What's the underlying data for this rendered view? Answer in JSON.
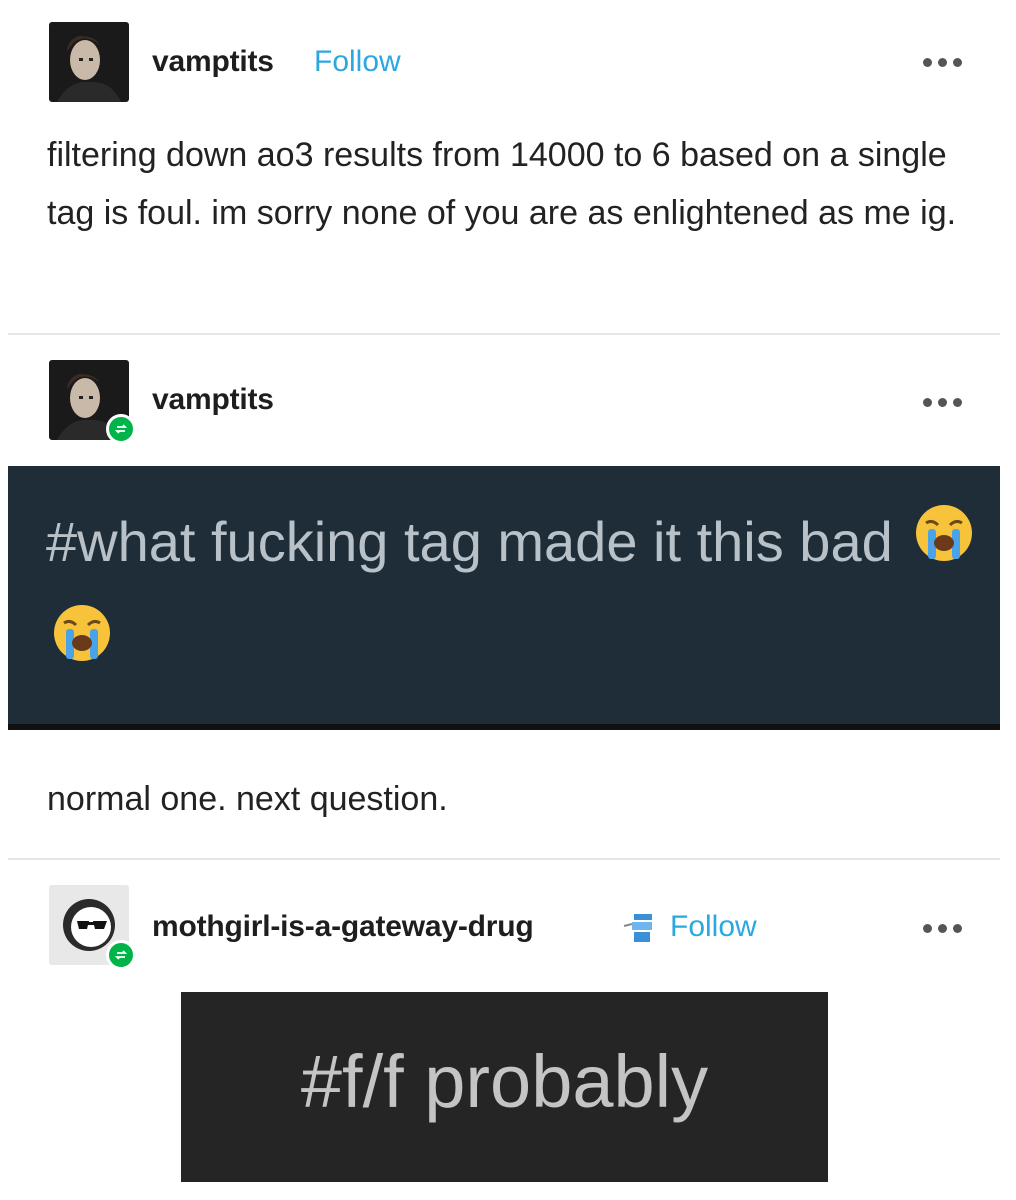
{
  "post1": {
    "username": "vamptits",
    "follow_label": "Follow",
    "body": "filtering down ao3 results from 14000 to 6 based on a single tag is foul. im sorry none of you are as enlightened as me ig.",
    "avatar": "avatar-photo",
    "menu_icon": "more-dots-icon"
  },
  "reblog1": {
    "username": "vamptits",
    "badge_icon": "reblog-icon",
    "tag_text": "#what fucking tag made it this bad",
    "tag_emoji": [
      "loudly-crying-face-emoji",
      "loudly-crying-face-emoji"
    ],
    "reply": "normal one. next question.",
    "menu_icon": "more-dots-icon"
  },
  "reblog2": {
    "username": "mothgirl-is-a-gateway-drug",
    "follow_label": "Follow",
    "badge_icon": "reblog-icon",
    "name_icon": "blue-figure-icon",
    "tag_text": "#f/f probably",
    "avatar": "sunglasses-face-avatar",
    "menu_icon": "more-dots-icon"
  },
  "colors": {
    "follow": "#2ba8e0",
    "reblog_badge": "#00b44a",
    "tag_box_dark_blue": "#1f2d38",
    "tag_box_dark": "#252525"
  }
}
